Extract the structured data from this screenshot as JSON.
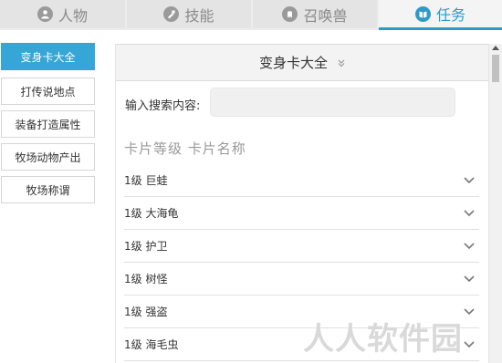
{
  "tabs": [
    {
      "label": "人物",
      "icon": "person-icon",
      "active": false
    },
    {
      "label": "技能",
      "icon": "skill-icon",
      "active": false
    },
    {
      "label": "召唤兽",
      "icon": "summon-icon",
      "active": false
    },
    {
      "label": "任务",
      "icon": "book-icon",
      "active": true
    }
  ],
  "sidebar": {
    "items": [
      {
        "label": "变身卡大全",
        "active": true
      },
      {
        "label": "打传说地点",
        "active": false
      },
      {
        "label": "装备打造属性",
        "active": false
      },
      {
        "label": "牧场动物产出",
        "active": false
      },
      {
        "label": "牧场称谓",
        "active": false
      }
    ]
  },
  "panel": {
    "title": "变身卡大全",
    "search_label": "输入搜索内容:",
    "search_value": "",
    "column_header": "卡片等级 卡片名称",
    "rows": [
      "1级 巨蛙",
      "1级 大海龟",
      "1级 护卫",
      "1级 树怪",
      "1级 强盗",
      "1级 海毛虫"
    ]
  },
  "watermark": "人人软件园",
  "colors": {
    "accent": "#2f9ac9",
    "sidebar_active": "#35a6d6"
  }
}
